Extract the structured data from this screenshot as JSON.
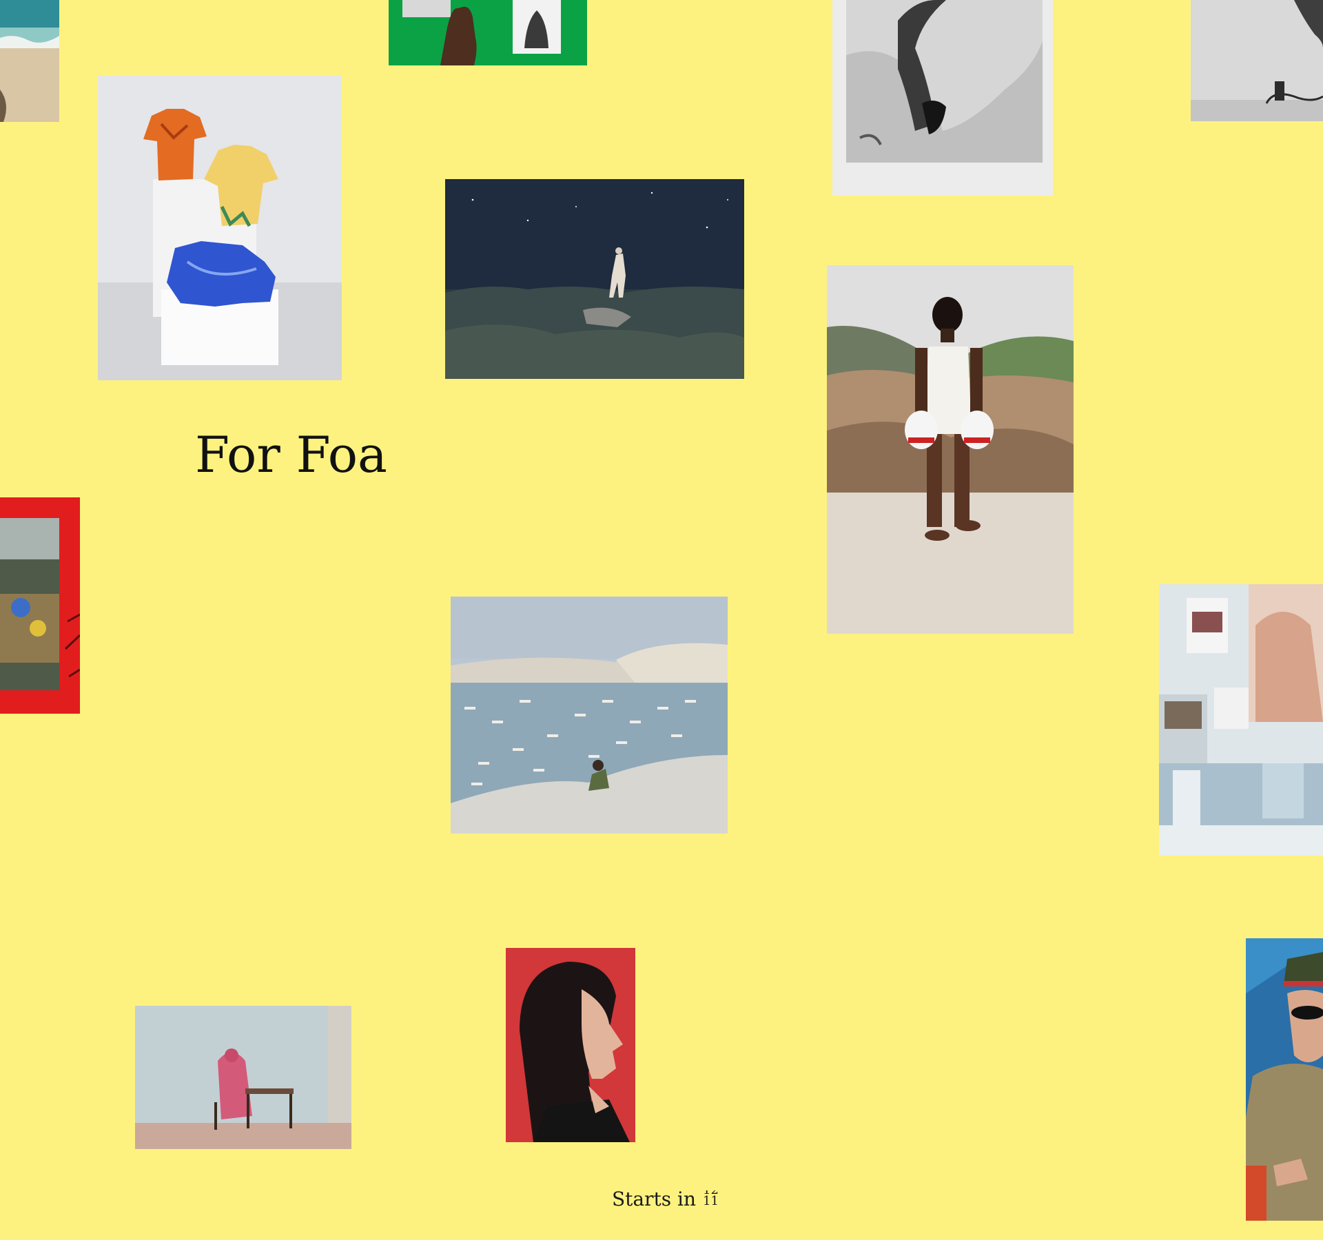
{
  "page": {
    "background": "#fdf27f"
  },
  "headline": "For Foa",
  "countdown": {
    "label": "Starts in",
    "previous_digit": "12",
    "current_digit": "11"
  },
  "gallery": [
    {
      "name": "photo-beach-sand",
      "subject": "beach with waves and sand"
    },
    {
      "name": "photo-hand-green-table",
      "subject": "hand over printed photos on green surface"
    },
    {
      "name": "photo-bw-rock-print",
      "subject": "black and white rock print"
    },
    {
      "name": "photo-gallery-installation-bw",
      "subject": "grey gallery installation with cables"
    },
    {
      "name": "photo-shirt-sculptures",
      "subject": "three colourful shirt sculptures on white plinths"
    },
    {
      "name": "photo-night-sky-figure",
      "subject": "figure standing on rock under a starry night sky"
    },
    {
      "name": "photo-boxer-beach",
      "subject": "young man in white swimsuit with boxing gloves on rocky beach"
    },
    {
      "name": "photo-red-frame-playground",
      "subject": "playground scene inside red framed border"
    },
    {
      "name": "photo-harbour-boats",
      "subject": "person seated on cliff above harbour full of boats"
    },
    {
      "name": "photo-studio-collage",
      "subject": "studio wall collage of photographs by window"
    },
    {
      "name": "photo-woman-pink-desk",
      "subject": "woman in pink robe seated at school desk"
    },
    {
      "name": "photo-woman-profile-red",
      "subject": "profile of woman against red background"
    },
    {
      "name": "photo-officer-portrait",
      "subject": "person in military cap and sunglasses"
    }
  ]
}
